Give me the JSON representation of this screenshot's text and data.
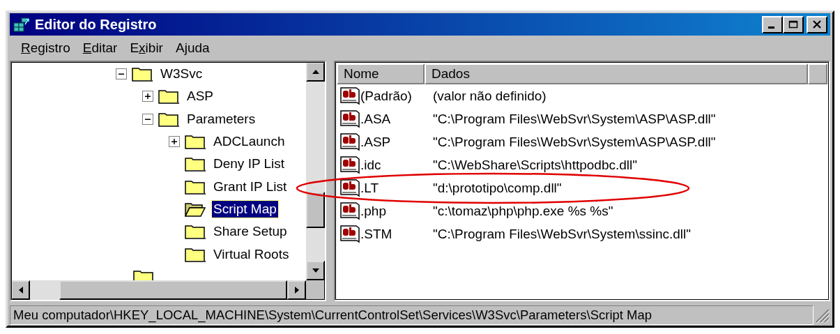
{
  "window": {
    "title": "Editor do Registro"
  },
  "menu": [
    {
      "key": "R",
      "post": "egistro"
    },
    {
      "key": "E",
      "post": "ditar"
    },
    {
      "pre": "E",
      "key": "x",
      "post": "ibir"
    },
    {
      "pre": "A",
      "key": "j",
      "post": "uda"
    }
  ],
  "tree": [
    {
      "label": "W3Svc",
      "kind": "branch",
      "expanded": true,
      "selected": false,
      "children": [
        {
          "label": "ASP",
          "kind": "branch",
          "expanded": false,
          "selected": false
        },
        {
          "label": "Parameters",
          "kind": "branch",
          "expanded": true,
          "selected": false,
          "children": [
            {
              "label": "ADCLaunch",
              "kind": "branch",
              "expanded": false,
              "selected": false
            },
            {
              "label": "Deny IP List",
              "kind": "leaf",
              "selected": false
            },
            {
              "label": "Grant IP List",
              "kind": "leaf",
              "selected": false
            },
            {
              "label": "Script Map",
              "kind": "leaf",
              "selected": true
            },
            {
              "label": "Share Setup",
              "kind": "leaf",
              "selected": false
            },
            {
              "label": "Virtual Roots",
              "kind": "leaf",
              "selected": false
            }
          ]
        }
      ]
    }
  ],
  "list": {
    "columns": [
      "Nome",
      "Dados"
    ],
    "rows": [
      {
        "name": "(Padrão)",
        "data": "(valor não definido)",
        "highlighted": false
      },
      {
        "name": ".ASA",
        "data": "\"C:\\Program Files\\WebSvr\\System\\ASP\\ASP.dll\"",
        "highlighted": false
      },
      {
        "name": ".ASP",
        "data": "\"C:\\Program Files\\WebSvr\\System\\ASP\\ASP.dll\"",
        "highlighted": false
      },
      {
        "name": ".idc",
        "data": "\"C:\\WebShare\\Scripts\\httpodbc.dll\"",
        "highlighted": false
      },
      {
        "name": ".LT",
        "data": "\"d:\\prototipo\\comp.dll\"",
        "highlighted": true
      },
      {
        "name": ".php",
        "data": "\"c:\\tomaz\\php\\php.exe %s %s\"",
        "highlighted": false
      },
      {
        "name": ".STM",
        "data": "\"C:\\Program Files\\WebSvr\\System\\ssinc.dll\"",
        "highlighted": false
      }
    ]
  },
  "status_bar": "Meu computador\\HKEY_LOCAL_MACHINE\\System\\CurrentControlSet\\Services\\W3Svc\\Parameters\\Script Map"
}
